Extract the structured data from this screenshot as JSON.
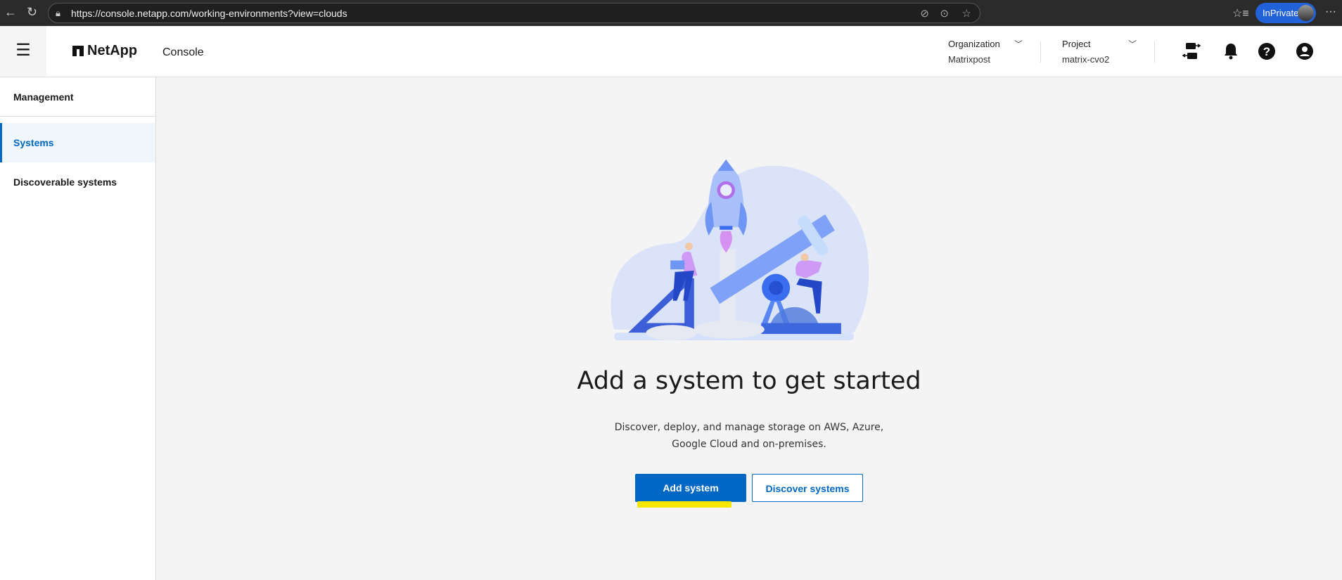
{
  "browser": {
    "url": "https://console.netapp.com/working-environments?view=clouds",
    "profile_label": "InPrivate",
    "icons": [
      "back-icon",
      "refresh-icon",
      "lock-icon",
      "tracking-prevention-icon",
      "more-circle-icon",
      "favorite-star-icon",
      "favorites-list-icon",
      "more-icon"
    ]
  },
  "header": {
    "logo": "NetApp",
    "app_name": "Console",
    "organization": {
      "label": "Organization",
      "value": "Matrixpost"
    },
    "project": {
      "label": "Project",
      "value": "matrix-cvo2"
    },
    "icons": [
      "connector-icon",
      "bell-icon",
      "help-icon",
      "user-icon"
    ]
  },
  "sidebar": {
    "title": "Management",
    "items": [
      {
        "label": "Systems",
        "active": true
      },
      {
        "label": "Discoverable systems",
        "active": false
      }
    ]
  },
  "main": {
    "heading": "Add a system to get started",
    "description_line1": "Discover, deploy, and manage storage on AWS, Azure,",
    "description_line2": "Google Cloud and on-premises.",
    "primary_button": "Add system",
    "secondary_button": "Discover systems"
  },
  "colors": {
    "accent": "#0067c5",
    "highlight": "#f5e600",
    "browser_bar": "#2b2b2b"
  }
}
